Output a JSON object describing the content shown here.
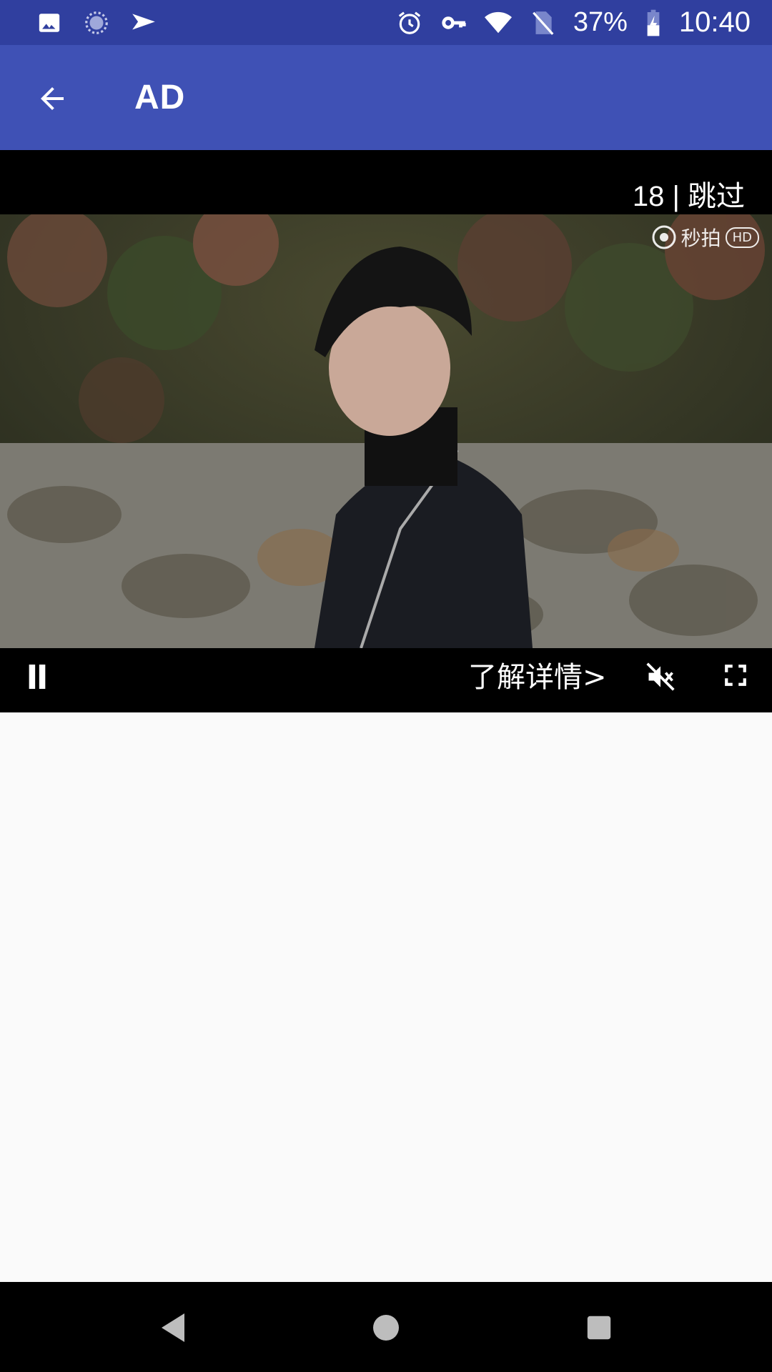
{
  "status_bar": {
    "left_icons": [
      "image-icon",
      "sync-icon",
      "send-icon"
    ],
    "right_icons": [
      "alarm-icon",
      "key-icon",
      "wifi-icon",
      "no-sim-icon"
    ],
    "battery_percent": "37%",
    "time": "10:40"
  },
  "app_bar": {
    "title": "AD",
    "back_icon": "arrow-back-icon",
    "background": "#3f51b5"
  },
  "ad": {
    "skip_text": "18 | 跳过",
    "watermark_text": "秒拍",
    "hd_label": "HD",
    "details_label": "了解详情>"
  },
  "controls": {
    "pause_icon": "pause-icon",
    "mute_icon": "volume-off-icon",
    "fullscreen_icon": "fullscreen-icon"
  },
  "nav_bar": {
    "back_icon": "nav-back-icon",
    "home_icon": "nav-home-icon",
    "recents_icon": "nav-recents-icon"
  },
  "colors": {
    "status_bar": "#303f9f",
    "app_bar": "#3f51b5",
    "video_background": "#000000",
    "content_background": "#fafafa"
  }
}
